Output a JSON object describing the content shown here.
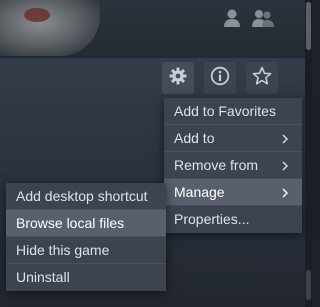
{
  "colors": {
    "menu_bg": "#3d4450",
    "menu_highlight": "#5a606b",
    "menu_text": "#dfe3e6",
    "page_bg": "#2a303b"
  },
  "header": {
    "icons": [
      "person-icon",
      "group-icon"
    ]
  },
  "toolbar": {
    "buttons": [
      "gear-icon",
      "info-icon",
      "star-icon"
    ]
  },
  "main_menu": {
    "items": [
      {
        "label": "Add to Favorites",
        "submenu": false
      },
      {
        "label": "Add to",
        "submenu": true
      },
      {
        "label": "Remove from",
        "submenu": true
      },
      {
        "label": "Manage",
        "submenu": true,
        "highlighted": true
      },
      {
        "label": "Properties...",
        "submenu": false
      }
    ]
  },
  "manage_submenu": {
    "items": [
      {
        "label": "Add desktop shortcut"
      },
      {
        "label": "Browse local files",
        "highlighted": true
      },
      {
        "label": "Hide this game"
      },
      {
        "label": "Uninstall"
      }
    ]
  }
}
